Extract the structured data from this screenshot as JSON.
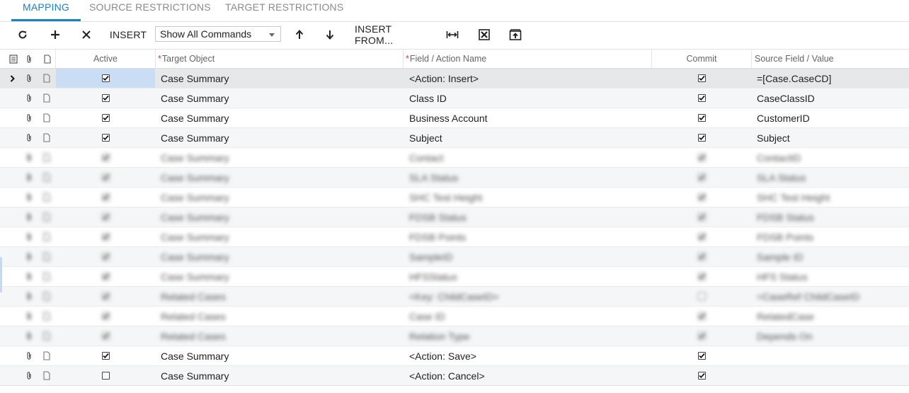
{
  "tabs": [
    {
      "label": "MAPPING",
      "active": true
    },
    {
      "label": "SOURCE RESTRICTIONS",
      "active": false
    },
    {
      "label": "TARGET RESTRICTIONS",
      "active": false
    }
  ],
  "toolbar": {
    "refresh_icon": "refresh-icon",
    "add_icon": "plus-icon",
    "delete_icon": "close-icon",
    "insert_label": "INSERT",
    "command_select_value": "Show All Commands",
    "move_up_icon": "arrow-up-icon",
    "move_down_icon": "arrow-down-icon",
    "insert_from_label": "INSERT FROM...",
    "fit_icon": "fit-columns-icon",
    "export_icon": "export-excel-icon",
    "upload_icon": "upload-icon"
  },
  "columns": {
    "active": "Active",
    "target_object": "Target Object",
    "field_action": "Field / Action Name",
    "commit": "Commit",
    "source_field": "Source Field / Value"
  },
  "rows": [
    {
      "active": true,
      "target": "Case Summary",
      "field": "<Action: Insert>",
      "commit": true,
      "source": "=[Case.CaseCD]",
      "blurred": false
    },
    {
      "active": true,
      "target": "Case Summary",
      "field": "Class ID",
      "commit": true,
      "source": "CaseClassID",
      "blurred": false
    },
    {
      "active": true,
      "target": "Case Summary",
      "field": "Business Account",
      "commit": true,
      "source": "CustomerID",
      "blurred": false
    },
    {
      "active": true,
      "target": "Case Summary",
      "field": "Subject",
      "commit": true,
      "source": "Subject",
      "blurred": false
    },
    {
      "active": true,
      "target": "Case Summary",
      "field": "Contact",
      "commit": true,
      "source": "ContactID",
      "blurred": true
    },
    {
      "active": true,
      "target": "Case Summary",
      "field": "SLA Status",
      "commit": true,
      "source": "SLA Status",
      "blurred": true
    },
    {
      "active": true,
      "target": "Case Summary",
      "field": "SHC Test Height",
      "commit": true,
      "source": "SHC Test Height",
      "blurred": true
    },
    {
      "active": true,
      "target": "Case Summary",
      "field": "FDSB Status",
      "commit": true,
      "source": "FDSB Status",
      "blurred": true
    },
    {
      "active": true,
      "target": "Case Summary",
      "field": "FDSB Points",
      "commit": true,
      "source": "FDSB Points",
      "blurred": true
    },
    {
      "active": true,
      "target": "Case Summary",
      "field": "SampleID",
      "commit": true,
      "source": "Sample ID",
      "blurred": true
    },
    {
      "active": true,
      "target": "Case Summary",
      "field": "HFSStatus",
      "commit": true,
      "source": "HFS Status",
      "blurred": true
    },
    {
      "active": true,
      "target": "Related Cases",
      "field": "<Key: ChildCaseID>",
      "commit": false,
      "source": "=CaseRef ChildCaseID",
      "blurred": true
    },
    {
      "active": true,
      "target": "Related Cases",
      "field": "Case ID",
      "commit": true,
      "source": "RelatedCase",
      "blurred": true
    },
    {
      "active": true,
      "target": "Related Cases",
      "field": "Relation Type",
      "commit": true,
      "source": "Depends On",
      "blurred": true
    },
    {
      "active": true,
      "target": "Case Summary",
      "field": "<Action: Save>",
      "commit": true,
      "source": "",
      "blurred": false
    },
    {
      "active": false,
      "target": "Case Summary",
      "field": "<Action: Cancel>",
      "commit": true,
      "source": "",
      "blurred": false
    }
  ]
}
